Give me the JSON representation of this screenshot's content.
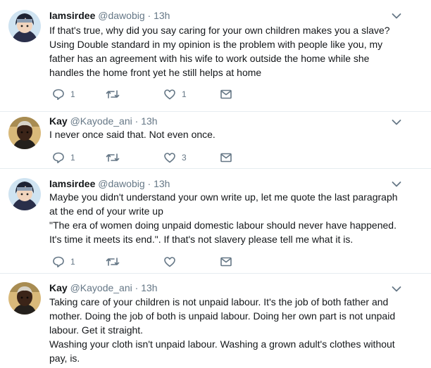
{
  "tweets": [
    {
      "name": "Iamsirdee",
      "handle": "@dawobig",
      "dot": "·",
      "time": "13h",
      "lines": [
        "If that's true, why did you say caring for your own children makes you a slave?",
        "Using Double standard in my opinion is the problem with people like you, my",
        "father has an agreement with his wife to work outside the home while she",
        "handles the home front yet he still helps at home"
      ],
      "replies": "1",
      "retweets": "",
      "likes": "1"
    },
    {
      "name": "Kay",
      "handle": "@Kayode_ani",
      "dot": "·",
      "time": "13h",
      "lines": [
        "I never once said that. Not even once."
      ],
      "replies": "1",
      "retweets": "",
      "likes": "3"
    },
    {
      "name": "Iamsirdee",
      "handle": "@dawobig",
      "dot": "·",
      "time": "13h",
      "lines": [
        "Maybe you didn't understand your own write up, let me quote the last paragraph",
        "at the end of your write up",
        "\"The era of women doing unpaid domestic labour should never have happened.",
        "It's time it meets its end.\". If that's not slavery please tell me what it is."
      ],
      "replies": "1",
      "retweets": "",
      "likes": ""
    },
    {
      "name": "Kay",
      "handle": "@Kayode_ani",
      "dot": "·",
      "time": "13h",
      "lines": [
        "Taking care of your children is not unpaid labour. It's the job of both father and",
        "mother. Doing the job of both is unpaid labour. Doing her own part is not unpaid",
        "labour. Get it straight.",
        "Washing your cloth isn't unpaid labour. Washing a grown adult's clothes without",
        "pay, is."
      ]
    }
  ],
  "icons": {
    "reply": "reply-icon",
    "retweet": "retweet-icon",
    "like": "heart-icon",
    "dm": "envelope-icon",
    "more": "chevron-down-icon"
  },
  "colors": {
    "text": "#14171a",
    "secondary": "#657786",
    "divider": "#e6ecf0"
  }
}
